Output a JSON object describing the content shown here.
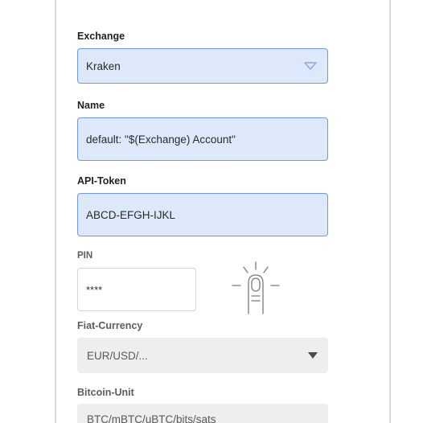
{
  "exchange": {
    "label": "Exchange",
    "value": "Kraken"
  },
  "name": {
    "label": "Name",
    "value": "default: \"$(Exchange) Account\""
  },
  "api_token": {
    "label": "API-Token",
    "value": "ABCD-EFGH-IJKL"
  },
  "pin": {
    "label": "PIN",
    "value": "****"
  },
  "fiat_currency": {
    "label": "Fiat-Currency",
    "value": "EUR/USD/..."
  },
  "bitcoin_unit": {
    "label": "Bitcoin-Unit",
    "value": "BTC/mBTC/uBTC/bits/sats"
  },
  "colors": {
    "field_blue_bg": "#dde8fb",
    "field_blue_border": "#6f9bdc",
    "field_grey_bg": "#eeeeef"
  },
  "icons": {
    "exchange_dropdown": "chevron-down-outline-icon",
    "fingerprint": "fingerprint-icon",
    "select_dropdown": "caret-down-icon"
  }
}
